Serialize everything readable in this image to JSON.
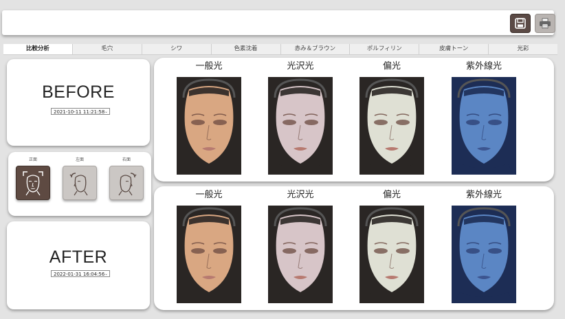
{
  "toolbar": {
    "save_icon": "save-icon",
    "print_icon": "printer-icon"
  },
  "tabs": [
    {
      "label": "比較分析",
      "active": true
    },
    {
      "label": "毛穴",
      "active": false
    },
    {
      "label": "シワ",
      "active": false
    },
    {
      "label": "色素沈着",
      "active": false
    },
    {
      "label": "赤み＆ブラウン",
      "active": false
    },
    {
      "label": "ポルフィリン",
      "active": false
    },
    {
      "label": "皮膚トーン",
      "active": false
    },
    {
      "label": "光彩",
      "active": false
    }
  ],
  "before": {
    "label": "BEFORE",
    "date": "2021-10-11 11:21:58"
  },
  "after": {
    "label": "AFTER",
    "date": "2022-01-31 16:04:56"
  },
  "angles": [
    {
      "label": "正面",
      "active": true,
      "icon": "face-front-icon"
    },
    {
      "label": "左面",
      "active": false,
      "icon": "face-left-icon"
    },
    {
      "label": "右面",
      "active": false,
      "icon": "face-right-icon"
    }
  ],
  "light_types": [
    "一般光",
    "光沢光",
    "偏光",
    "紫外線光"
  ],
  "colors": {
    "normal_skin": "#d9a782",
    "gloss_skin": "#d7c5c8",
    "polar_skin": "#dfe0d4",
    "uv_skin": "#5b86c4"
  }
}
